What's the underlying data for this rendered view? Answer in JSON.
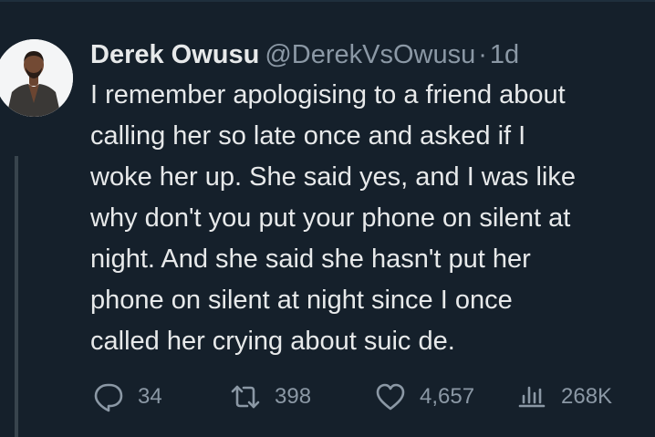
{
  "tweet": {
    "display_name": "Derek Owusu",
    "handle": "@DerekVsOwusu",
    "separator": "·",
    "time": "1d",
    "lines": [
      "I remember apologising to a friend about",
      "calling her so late once and asked if I",
      "woke her up. She said yes, and I was like",
      "why don't you put your phone on silent at",
      "night. And she said she hasn't put her",
      "phone on silent at night since I once",
      "called her crying about suic de."
    ]
  },
  "actions": {
    "replies": "34",
    "retweets": "398",
    "likes": "4,657",
    "views": "268K"
  },
  "icons": {
    "reply": "reply-icon",
    "retweet": "retweet-icon",
    "like": "heart-icon",
    "views": "views-icon"
  },
  "colors": {
    "background": "#15202b",
    "primary_text": "#e7e9ea",
    "secondary_text": "#8b98a5",
    "thread_line": "#38444d"
  }
}
